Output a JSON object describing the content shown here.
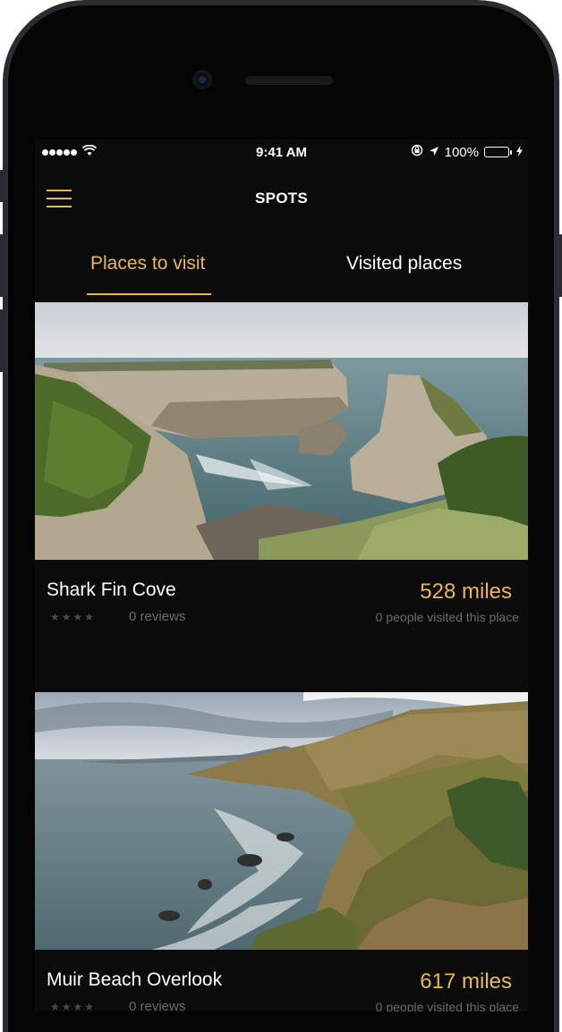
{
  "status_bar": {
    "time": "9:41 AM",
    "battery": "100%",
    "icons": [
      "signal-dots-icon",
      "wifi-icon",
      "orientation-lock-icon",
      "location-arrow-icon",
      "battery-icon",
      "charging-bolt-icon"
    ]
  },
  "header": {
    "title": "SPOTS",
    "menu_icon": "hamburger-menu-icon"
  },
  "tabs": [
    {
      "label": "Places to visit",
      "active": true
    },
    {
      "label": "Visited places",
      "active": false
    }
  ],
  "places": [
    {
      "name": "Shark Fin Cove",
      "rating_stars": "★★★★",
      "reviews": "0 reviews",
      "distance": "528 miles",
      "visited": "0 people visited this place"
    },
    {
      "name": "Muir Beach Overlook",
      "rating_stars": "★★★★",
      "reviews": "0 reviews",
      "distance": "617 miles",
      "visited": "0 people visited this place"
    }
  ],
  "colors": {
    "accent": "#ecb755",
    "background": "#0b0b0c",
    "battery": "#f5c21b",
    "muted_text": "#6b6b6b"
  }
}
